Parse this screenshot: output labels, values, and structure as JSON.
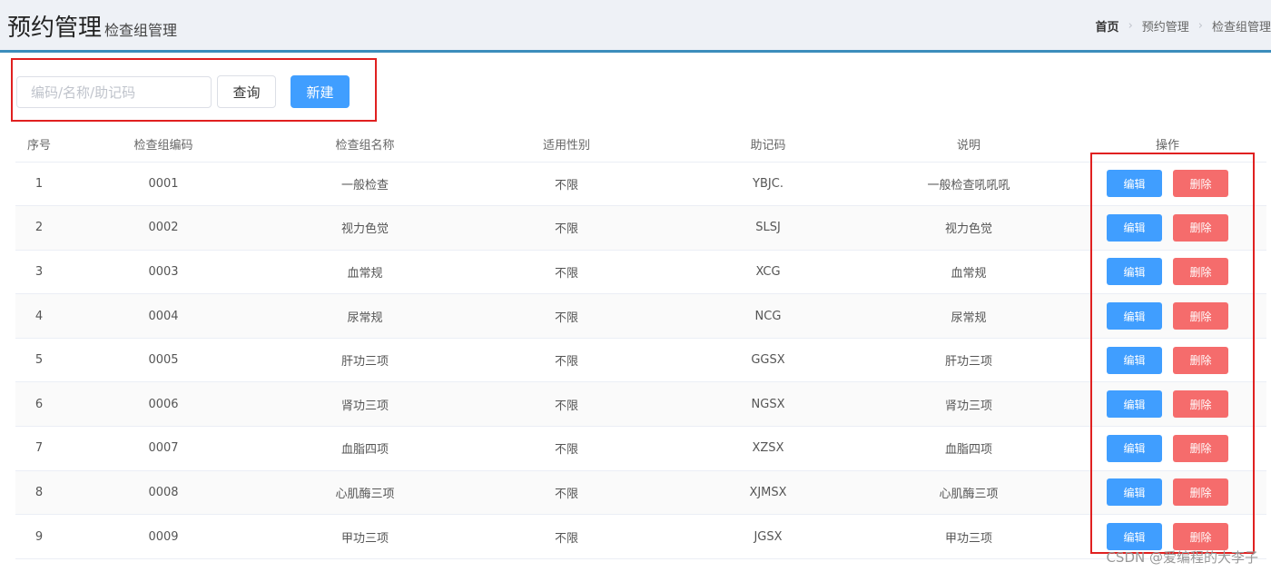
{
  "header": {
    "title": "预约管理",
    "subtitle": "检查组管理",
    "breadcrumb": [
      "首页",
      "预约管理",
      "检查组管理"
    ]
  },
  "toolbar": {
    "search_placeholder": "编码/名称/助记码",
    "search_value": "",
    "query_label": "查询",
    "new_label": "新建"
  },
  "table": {
    "columns": [
      "序号",
      "检查组编码",
      "检查组名称",
      "适用性别",
      "助记码",
      "说明",
      "操作"
    ],
    "rows": [
      {
        "index": "1",
        "code": "0001",
        "name": "一般检查",
        "gender": "不限",
        "mnemonic": "YBJC.",
        "remark": "一般检查吼吼吼"
      },
      {
        "index": "2",
        "code": "0002",
        "name": "视力色觉",
        "gender": "不限",
        "mnemonic": "SLSJ",
        "remark": "视力色觉"
      },
      {
        "index": "3",
        "code": "0003",
        "name": "血常规",
        "gender": "不限",
        "mnemonic": "XCG",
        "remark": "血常规"
      },
      {
        "index": "4",
        "code": "0004",
        "name": "尿常规",
        "gender": "不限",
        "mnemonic": "NCG",
        "remark": "尿常规"
      },
      {
        "index": "5",
        "code": "0005",
        "name": "肝功三项",
        "gender": "不限",
        "mnemonic": "GGSX",
        "remark": "肝功三项"
      },
      {
        "index": "6",
        "code": "0006",
        "name": "肾功三项",
        "gender": "不限",
        "mnemonic": "NGSX",
        "remark": "肾功三项"
      },
      {
        "index": "7",
        "code": "0007",
        "name": "血脂四项",
        "gender": "不限",
        "mnemonic": "XZSX",
        "remark": "血脂四项"
      },
      {
        "index": "8",
        "code": "0008",
        "name": "心肌酶三项",
        "gender": "不限",
        "mnemonic": "XJMSX",
        "remark": "心肌酶三项"
      },
      {
        "index": "9",
        "code": "0009",
        "name": "甲功三项",
        "gender": "不限",
        "mnemonic": "JGSX",
        "remark": "甲功三项"
      }
    ],
    "edit_label": "编辑",
    "delete_label": "删除"
  },
  "watermark": "CSDN @爱编程的大李子",
  "colors": {
    "primary": "#409eff",
    "danger": "#f56c6c",
    "annotation": "#e02020",
    "header_bg": "#eef1f6"
  }
}
